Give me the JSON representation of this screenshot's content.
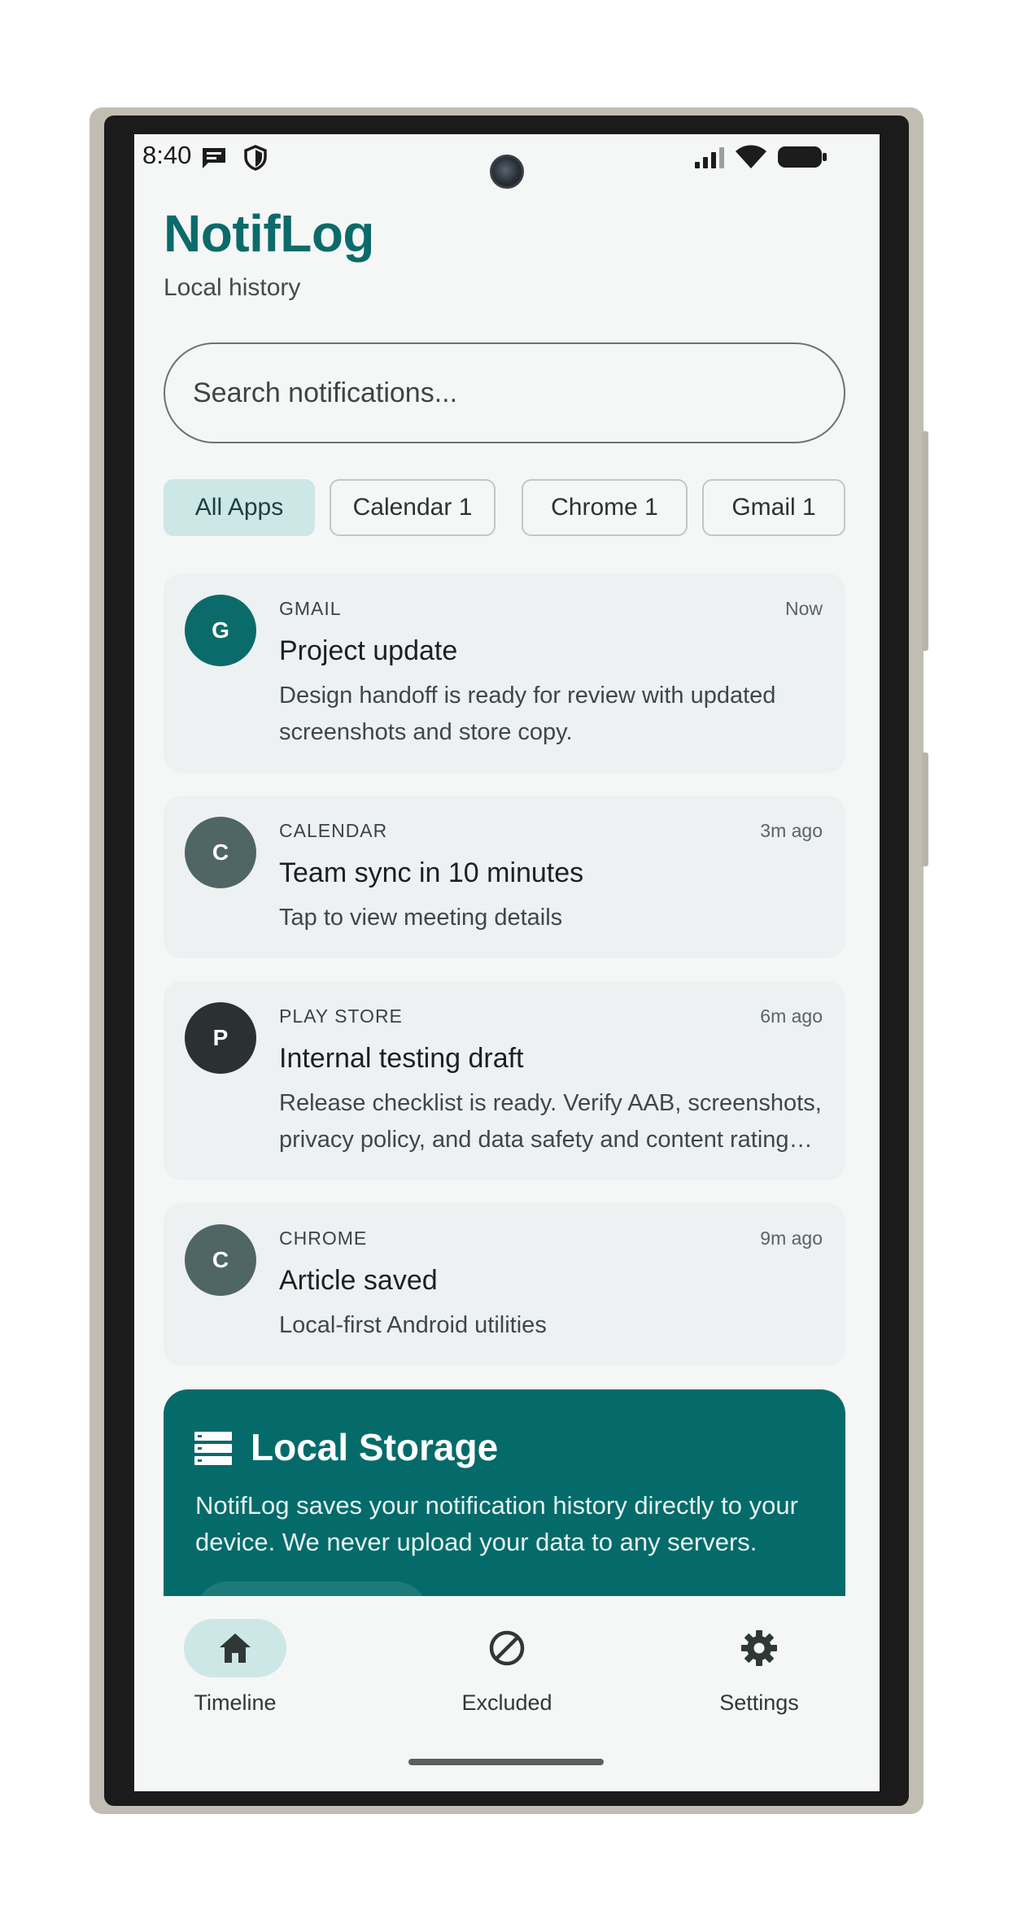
{
  "status_bar": {
    "time": "8:40"
  },
  "header": {
    "title": "NotifLog",
    "subtitle": "Local history"
  },
  "search": {
    "placeholder": "Search notifications..."
  },
  "filters": [
    {
      "label": "All Apps",
      "selected": true
    },
    {
      "label": "Calendar 1",
      "selected": false
    },
    {
      "label": "Chrome 1",
      "selected": false
    },
    {
      "label": "Gmail 1",
      "selected": false
    }
  ],
  "notifications": [
    {
      "avatar_letter": "G",
      "avatar_color": "#0b6b6a",
      "app": "GMAIL",
      "time": "Now",
      "title": "Project update",
      "body": "Design handoff is ready for review with updated screenshots and store copy."
    },
    {
      "avatar_letter": "C",
      "avatar_color": "#4f6665",
      "app": "CALENDAR",
      "time": "3m ago",
      "title": "Team sync in 10 minutes",
      "body": "Tap to view meeting details"
    },
    {
      "avatar_letter": "P",
      "avatar_color": "#2b3132",
      "app": "PLAY STORE",
      "time": "6m ago",
      "title": "Internal testing draft",
      "body": "Release checklist is ready. Verify AAB, screenshots, privacy policy, and data safety and content rating details."
    },
    {
      "avatar_letter": "C",
      "avatar_color": "#4f6665",
      "app": "CHROME",
      "time": "9m ago",
      "title": "Article saved",
      "body": "Local-first Android utilities"
    }
  ],
  "storage_card": {
    "title": "Local Storage",
    "text": "NotifLog saves your notification history directly to your device. We never upload your data to any servers.",
    "icon": "storage-icon"
  },
  "bottom_nav": [
    {
      "label": "Timeline",
      "icon": "home-icon",
      "active": true
    },
    {
      "label": "Excluded",
      "icon": "block-icon",
      "active": false
    },
    {
      "label": "Settings",
      "icon": "gear-icon",
      "active": false
    }
  ],
  "colors": {
    "accent": "#0b6b6a",
    "chip_selected": "#cde7e7",
    "card_background": "#edf1f2",
    "storage_card": "#046b6a"
  }
}
